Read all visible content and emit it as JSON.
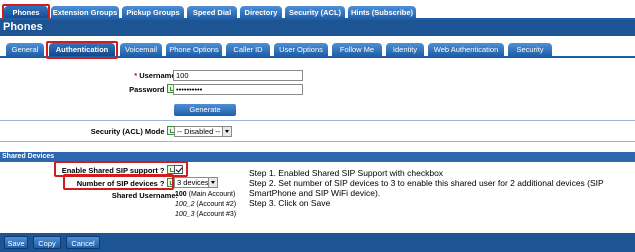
{
  "top_tabs": [
    "Phones",
    "Extension Groups",
    "Pickup Groups",
    "Speed Dial",
    "Directory",
    "Security (ACL)",
    "Hints (Subscribe)"
  ],
  "title": "Phones",
  "sub_tabs": [
    "General",
    "Authentication",
    "Voicemail",
    "Phone Options",
    "Caller ID",
    "User Options",
    "Follow Me",
    "Identity",
    "Web Authentication",
    "Security"
  ],
  "form": {
    "username_label": "Username:",
    "username_value": "100",
    "password_label": "Password",
    "password_value": "••••••••••",
    "generate_password": "Generate Password",
    "security_acl_label": "Security (ACL) Mode",
    "security_acl_value": "-- Disabled --"
  },
  "shared": {
    "section_title": "Shared Devices",
    "enable_label": "Enable Shared SIP support ?",
    "num_devices_label": "Number of SIP devices ?",
    "num_devices_value": "3 devices",
    "shared_username_label": "Shared Username:",
    "main_user": "100",
    "main_user_suffix": " (Main Account)",
    "acct2": "100_2",
    "acct2_suffix": " (Account #2)",
    "acct3": "100_3",
    "acct3_suffix": " (Account #3)"
  },
  "steps": {
    "step1": "Step 1. Enabled Shared SIP Support with checkbox",
    "step2": "Step 2. Set number of SIP devices to 3 to enable this shared user for 2 additional devices (SIP SmartPhone and SIP WiFi device).",
    "step3": "Step 3. Click on Save"
  },
  "buttons": {
    "save": "Save",
    "copy": "Copy",
    "cancel": "Cancel"
  },
  "colors": {
    "header_blue": "#1c5494",
    "tab_blue": "#1f5fa8",
    "highlight_red": "#d21d1d"
  }
}
